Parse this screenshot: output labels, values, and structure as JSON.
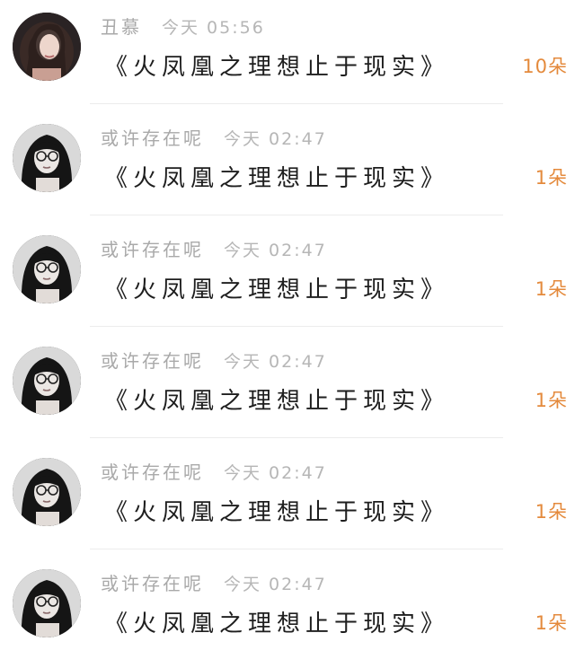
{
  "message_list": {
    "items": [
      {
        "name": "丑慕",
        "time": "今天 05:56",
        "message": "《火凤凰之理想止于现实》",
        "count": "10朵",
        "avatar": "woman-long-hair"
      },
      {
        "name": "或许存在呢",
        "time": "今天 02:47",
        "message": "《火凤凰之理想止于现实》",
        "count": "1朵",
        "avatar": "woman-glasses"
      },
      {
        "name": "或许存在呢",
        "time": "今天 02:47",
        "message": "《火凤凰之理想止于现实》",
        "count": "1朵",
        "avatar": "woman-glasses"
      },
      {
        "name": "或许存在呢",
        "time": "今天 02:47",
        "message": "《火凤凰之理想止于现实》",
        "count": "1朵",
        "avatar": "woman-glasses"
      },
      {
        "name": "或许存在呢",
        "time": "今天 02:47",
        "message": "《火凤凰之理想止于现实》",
        "count": "1朵",
        "avatar": "woman-glasses"
      },
      {
        "name": "或许存在呢",
        "time": "今天 02:47",
        "message": "《火凤凰之理想止于现实》",
        "count": "1朵",
        "avatar": "woman-glasses"
      }
    ]
  },
  "colors": {
    "name": "#a9a9a9",
    "time": "#b6b6b6",
    "message": "#1e1e1e",
    "count": "#e48a3c",
    "divider": "#ececec"
  }
}
